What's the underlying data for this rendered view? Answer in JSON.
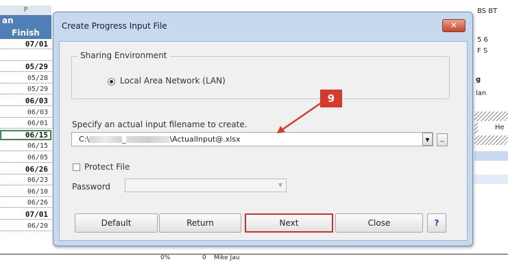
{
  "sheet": {
    "col_letter": "P",
    "left_header_1": "an",
    "left_header_2": "Finish",
    "rows": [
      {
        "text": "07/01",
        "bold": true
      },
      {
        "text": "",
        "bold": false
      },
      {
        "text": "05/29",
        "bold": true
      },
      {
        "text": "05/28",
        "bold": false
      },
      {
        "text": "05/29",
        "bold": false
      },
      {
        "text": "06/03",
        "bold": true
      },
      {
        "text": "06/03",
        "bold": false
      },
      {
        "text": "06/01",
        "bold": false
      },
      {
        "text": "06/15",
        "bold": true,
        "selected": true
      },
      {
        "text": "06/15",
        "bold": false
      },
      {
        "text": "06/05",
        "bold": false
      },
      {
        "text": "06/26",
        "bold": true
      },
      {
        "text": "06/23",
        "bold": false
      },
      {
        "text": "06/10",
        "bold": false
      },
      {
        "text": "06/26",
        "bold": false
      },
      {
        "text": "07/01",
        "bold": true
      },
      {
        "text": "06/20",
        "bold": false
      }
    ],
    "right_col_headers": "BS BT",
    "right_days": "5  6",
    "right_weekdays": "F  S",
    "right_text_1": "g",
    "right_text_2": "lan",
    "right_text_3": "He",
    "bottom_percent": "0%",
    "bottom_zero": "0",
    "bottom_name": "Mike Jau"
  },
  "dialog": {
    "title": "Create Progress Input File",
    "close_glyph": "✕",
    "sharing_group_label": "Sharing Environment",
    "lan_option_label": "Local Area Network (LAN)",
    "filename_label": "Specify an actual input filename to create.",
    "filename_prefix": "C:\\",
    "filename_sep": "_",
    "filename_suffix": "\\ActualInput@.xlsx",
    "combo_arrow_glyph": "▼",
    "browse_glyph": "_",
    "protect_label": "Protect File",
    "password_label": "Password",
    "password_value": "",
    "password_arrow_glyph": "▼",
    "buttons": {
      "default": "Default",
      "return": "Return",
      "next": "Next",
      "close": "Close",
      "help": "?"
    }
  },
  "annotation": {
    "callout_number": "9",
    "callout_color": "#d8392b"
  }
}
